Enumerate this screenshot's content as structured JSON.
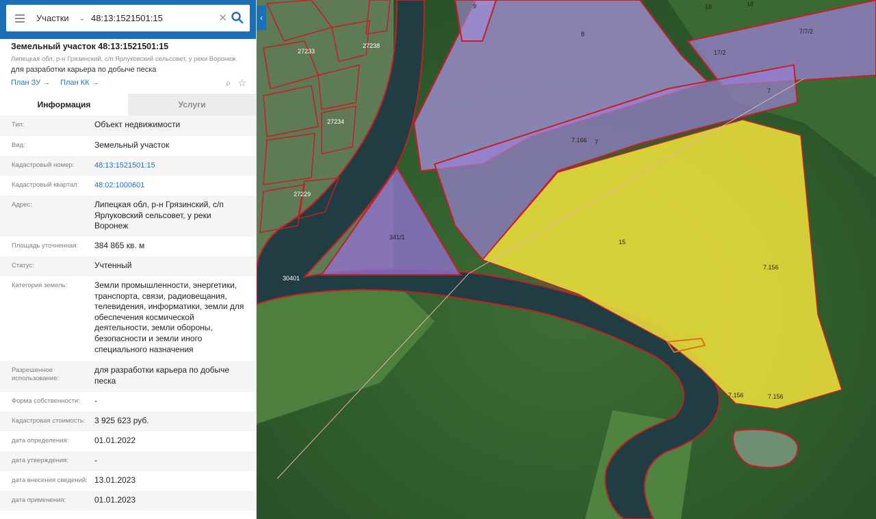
{
  "search": {
    "layer": "Участки",
    "value": "48:13:1521501:15"
  },
  "object": {
    "title": "Земельный участок 48:13:1521501:15",
    "address_short": "Липецкая обл, р-н Грязинский, с/п Ярлуковский сельсовет, у реки Воронеж",
    "purpose": "для разработки карьера по добыче песка",
    "link_plan_zu": "План ЗУ →",
    "link_plan_kk": "План КК →"
  },
  "tabs": {
    "info": "Информация",
    "services": "Услуги"
  },
  "rows": [
    {
      "key": "Тип:",
      "value": "Объект недвижимости"
    },
    {
      "key": "Вид:",
      "value": "Земельный участок"
    },
    {
      "key": "Кадастровый номер:",
      "value": "48:13:1521501:15"
    },
    {
      "key": "Кадастровый квартал:",
      "value": "48:02:1000601"
    },
    {
      "key": "Адрес:",
      "value": "Липецкая обл, р-н Грязинский, с/п Ярлуковский сельсовет, у реки Воронеж"
    },
    {
      "key": "Площадь уточненная:",
      "value": "384 865 кв. м"
    },
    {
      "key": "Статус:",
      "value": "Учтенный"
    },
    {
      "key": "Категория земель:",
      "value": "Земли промышленности, энергетики, транспорта, связи, радиовещания, телевидения, информатики, земли для обеспечения космической деятельности, земли обороны, безопасности и земли иного специального назначения"
    },
    {
      "key": "Разрешенное использование:",
      "value": "для разработки карьера по добыче песка"
    },
    {
      "key": "Форма собственности:",
      "value": "-"
    },
    {
      "key": "Кадастровая стоимость:",
      "value": "3 925 623 руб."
    },
    {
      "key": "дата определения:",
      "value": "01.01.2022"
    },
    {
      "key": "дата утверждения:",
      "value": "-"
    },
    {
      "key": "дата внесения сведений:",
      "value": "13.01.2023"
    },
    {
      "key": "дата применения:",
      "value": "01.01.2023"
    }
  ],
  "map_labels": {
    "p8": "8",
    "p9": "9",
    "p7": "7",
    "p7_166": "7.166",
    "p7_b": "7",
    "p17_2": "17/2",
    "p17_2b": "7/7/2",
    "p18a": "18",
    "p18b": "18",
    "p341": "341/1",
    "p15": "15",
    "p7_156a": "7.156",
    "p7_156b": "7.156",
    "p7_156c": "7.156",
    "q27233": "27233",
    "q27238": "27238",
    "q27234": "27234",
    "q27229": "27229",
    "q30401": "30401"
  },
  "colors": {
    "header_blue": "#1a6fb5",
    "link_blue": "#1a73c0",
    "selected_parcel": "#f2e33a",
    "parcel_purple": "#9a7fd0",
    "boundary_red": "#d0202a"
  }
}
